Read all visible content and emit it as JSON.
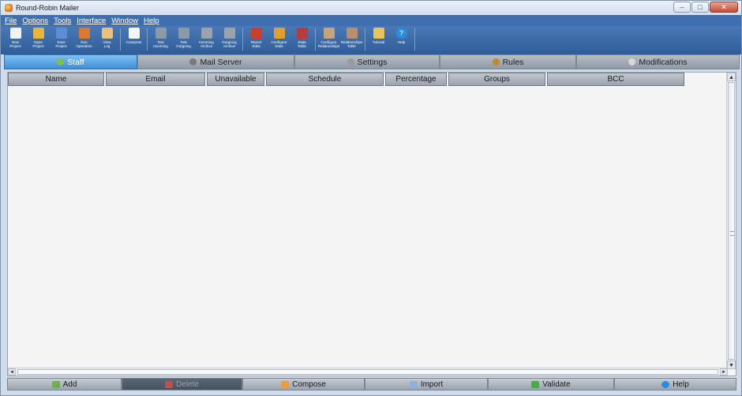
{
  "window": {
    "title": "Round-Robin Mailer",
    "controls": {
      "minimize": "–",
      "maximize": "□",
      "close": "✕"
    }
  },
  "menu": [
    "File",
    "Options",
    "Tools",
    "Interface",
    "Window",
    "Help"
  ],
  "toolbar": [
    {
      "label": "New\nProject",
      "icon": "new-project-icon",
      "color": "#f2f2f2"
    },
    {
      "label": "Open\nProject",
      "icon": "open-project-icon",
      "color": "#e8b53a"
    },
    {
      "label": "Save\nProject",
      "icon": "save-project-icon",
      "color": "#5a8fd6"
    },
    {
      "label": "Run\nOperation",
      "icon": "run-operation-icon",
      "color": "#d9782e"
    },
    {
      "label": "View\nLog",
      "icon": "view-log-icon",
      "color": "#e6c27a"
    },
    {
      "label": "Compose",
      "icon": "compose-icon",
      "color": "#f5f5f5"
    },
    {
      "label": "Test\nIncoming",
      "icon": "test-incoming-icon",
      "color": "#8d98a8"
    },
    {
      "label": "Test\nOutgoing",
      "icon": "test-outgoing-icon",
      "color": "#8d98a8"
    },
    {
      "label": "Incoming\nArchive",
      "icon": "incoming-archive-icon",
      "color": "#9aa3ad"
    },
    {
      "label": "Outgoing\nArchive",
      "icon": "outgoing-archive-icon",
      "color": "#9aa3ad"
    },
    {
      "label": "Report\nStats",
      "icon": "report-stats-icon",
      "color": "#c9402a"
    },
    {
      "label": "Configure\nStats",
      "icon": "configure-stats-icon",
      "color": "#e0a030"
    },
    {
      "label": "Stats\nTable",
      "icon": "stats-table-icon",
      "color": "#b83a3a"
    },
    {
      "label": "Configure\nRelationships",
      "icon": "configure-relationships-icon",
      "color": "#c9a27a"
    },
    {
      "label": "Relationships\nTable",
      "icon": "relationships-table-icon",
      "color": "#b88f6a"
    },
    {
      "label": "Tutorial",
      "icon": "tutorial-icon",
      "color": "#e8c25a"
    },
    {
      "label": "Help",
      "icon": "help-icon",
      "color": "#2a8be0"
    }
  ],
  "tabs": [
    {
      "label": "Staff",
      "icon": "staff-icon",
      "active": true,
      "color": "#7fbf4a"
    },
    {
      "label": "Mail Server",
      "icon": "mail-server-icon",
      "active": false,
      "color": "#7a7a7a"
    },
    {
      "label": "Settings",
      "icon": "settings-icon",
      "active": false,
      "color": "#9a9a9a"
    },
    {
      "label": "Rules",
      "icon": "rules-icon",
      "active": false,
      "color": "#c08a30"
    },
    {
      "label": "Modifications",
      "icon": "modifications-icon",
      "active": false,
      "color": "#d8d8d8"
    }
  ],
  "columns": [
    "Name",
    "Email",
    "Unavailable",
    "Schedule",
    "Percentage",
    "Groups",
    "BCC"
  ],
  "scroll": {
    "up": "▲",
    "down": "▼",
    "left": "◄",
    "right": "►"
  },
  "actions": [
    {
      "label": "Add",
      "icon": "add-icon",
      "disabled": false,
      "color": "#6fae4a"
    },
    {
      "label": "Delete",
      "icon": "delete-icon",
      "disabled": true,
      "color": "#c0504d"
    },
    {
      "label": "Compose",
      "icon": "compose-icon",
      "disabled": false,
      "color": "#e8a030"
    },
    {
      "label": "Import",
      "icon": "import-icon",
      "disabled": false,
      "color": "#8fb0d8"
    },
    {
      "label": "Validate",
      "icon": "validate-icon",
      "disabled": false,
      "color": "#4aa84a"
    },
    {
      "label": "Help",
      "icon": "help-icon",
      "disabled": false,
      "color": "#2a8be0"
    }
  ]
}
